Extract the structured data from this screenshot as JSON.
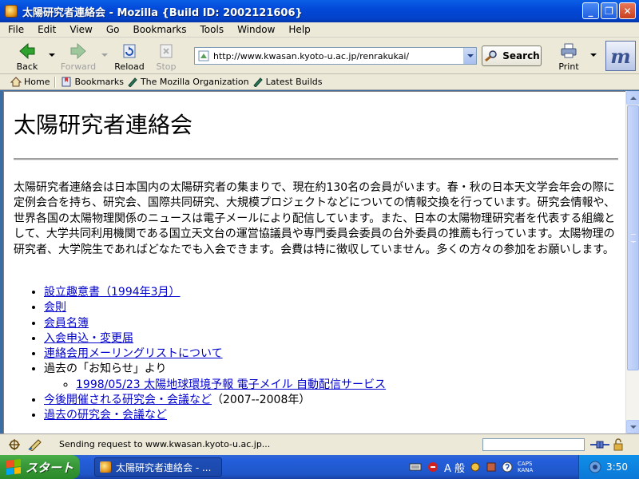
{
  "window": {
    "title": "太陽研究者連絡会 - Mozilla {Build ID: 2002121606}",
    "buttons": {
      "minimize": "_",
      "maximize": "❐",
      "close": "✕"
    }
  },
  "menu": [
    "File",
    "Edit",
    "View",
    "Go",
    "Bookmarks",
    "Tools",
    "Window",
    "Help"
  ],
  "nav": {
    "back": "Back",
    "forward": "Forward",
    "reload": "Reload",
    "stop": "Stop",
    "url": "http://www.kwasan.kyoto-u.ac.jp/renrakukai/",
    "search": "Search",
    "print": "Print",
    "brand": "m"
  },
  "personal": [
    "Home",
    "Bookmarks",
    "The Mozilla Organization",
    "Latest Builds"
  ],
  "page": {
    "heading": "太陽研究者連絡会",
    "intro": "太陽研究者連絡会は日本国内の太陽研究者の集まりで、現在約130名の会員がいます。春・秋の日本天文学会年会の際に定例会合を持ち、研究会、国際共同研究、大規模プロジェクトなどについての情報交換を行っています。研究会情報や、世界各国の太陽物理関係のニュースは電子メールにより配信しています。また、日本の太陽物理研究者を代表する組織として、大学共同利用機関である国立天文台の運営協議員や専門委員会委員の台外委員の推薦も行っています。太陽物理の研究者、大学院生であればどなたでも入会できます。会費は特に徴収していません。多くの方々の参加をお願いします。",
    "links": {
      "l1": "設立趣意書（1994年3月）",
      "l2": "会則",
      "l3": "会員名簿",
      "l4": "入会申込・変更届",
      "l5": "連絡会用メーリングリストについて",
      "past_news_label": "過去の「お知らせ」より",
      "sub1": "1998/05/23 太陽地球環境予報 電子メイル 自動配信サービス",
      "l6": "今後開催される研究会・会議など",
      "l6_suffix": "（2007--2008年）",
      "l7": "過去の研究会・会議など"
    }
  },
  "status": {
    "text": "Sending request to www.kwasan.kyoto-u.ac.jp..."
  },
  "taskbar": {
    "start": "スタート",
    "task": "太陽研究者連絡会 - ...",
    "ime_mode": "A 般",
    "caps": "CAPS",
    "kana": "KANA",
    "clock": "3:50"
  }
}
